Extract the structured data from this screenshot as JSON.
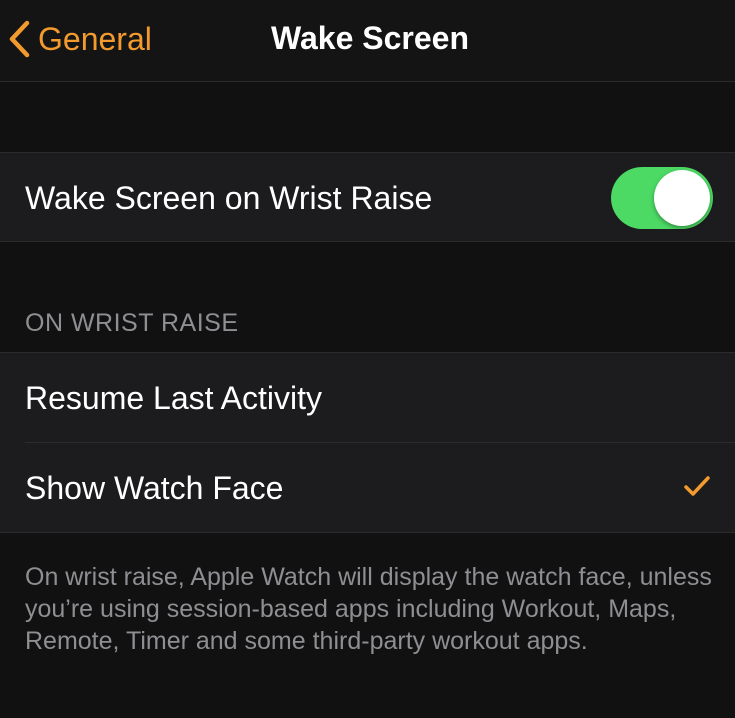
{
  "navbar": {
    "back_label": "General",
    "title": "Wake Screen",
    "accent_color": "#f29a2e"
  },
  "wake_toggle": {
    "label": "Wake Screen on Wrist Raise",
    "enabled": true,
    "on_color": "#4cd964"
  },
  "on_wrist_raise": {
    "header": "ON WRIST RAISE",
    "options": [
      {
        "label": "Resume Last Activity",
        "selected": false
      },
      {
        "label": "Show Watch Face",
        "selected": true
      }
    ],
    "checkmark_icon": "checkmark-icon"
  },
  "footer": {
    "text": "On wrist raise, Apple Watch will display the watch face, unless you’re using session-based apps including Workout, Maps, Remote, Timer and some third-party workout apps."
  }
}
